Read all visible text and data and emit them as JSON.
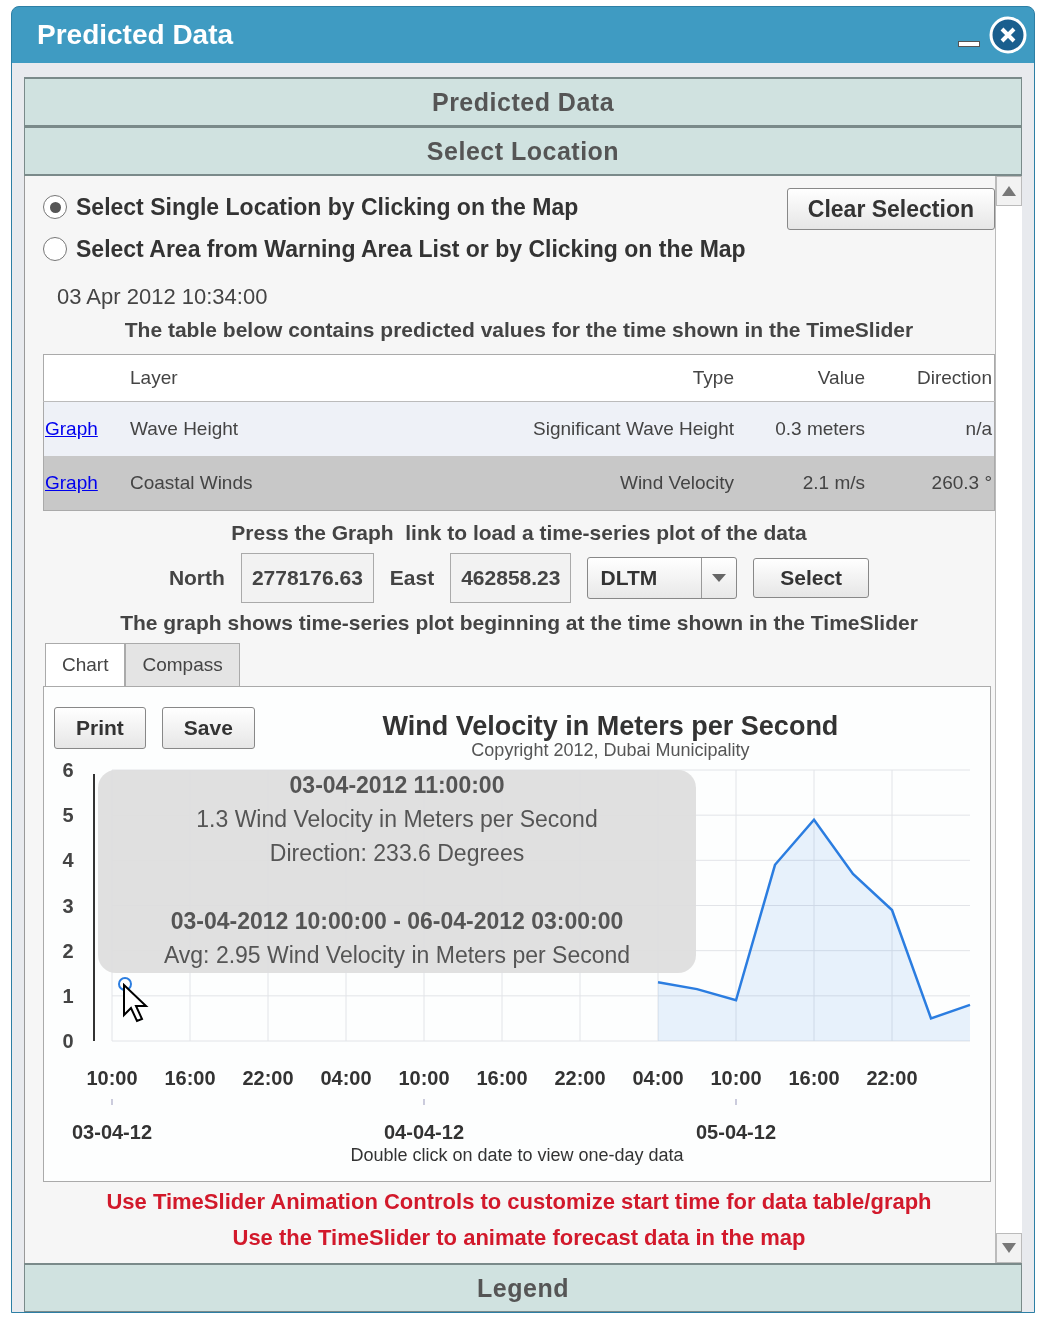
{
  "window": {
    "title": "Predicted Data"
  },
  "accordion": [
    {
      "title": "Predicted Data",
      "expanded": false
    },
    {
      "title": "Select Location",
      "expanded": true
    },
    {
      "title": "Legend",
      "expanded": false
    }
  ],
  "location": {
    "options": [
      {
        "label": "Select Single Location by Clicking on the Map",
        "selected": true
      },
      {
        "label": "Select Area from Warning Area List or by Clicking on the Map",
        "selected": false
      }
    ],
    "clear_button": "Clear Selection",
    "timestamp": "03 Apr 2012 10:34:00",
    "table_note": "The table below contains predicted values for the time shown in the TimeSlider",
    "table": {
      "columns": [
        "Layer",
        "Type",
        "Value",
        "Direction"
      ],
      "rows": [
        {
          "link": "Graph",
          "layer": "Wave Height",
          "type": "Significant Wave Height",
          "value": "0.3 meters",
          "direction": "n/a",
          "selected": false
        },
        {
          "link": "Graph",
          "layer": "Coastal Winds",
          "type": "Wind Velocity",
          "value": "2.1 m/s",
          "direction": "260.3 °",
          "selected": true
        }
      ]
    },
    "graph_note": "Press the Graph  link to load a time-series plot of the data",
    "north": {
      "label": "North",
      "value": "2778176.63"
    },
    "east": {
      "label": "East",
      "value": "462858.23"
    },
    "projection": {
      "value": "DLTM"
    },
    "select_button": "Select",
    "graph_note_2": "The graph shows time-series plot beginning at the time shown in the TimeSlider",
    "tabs": [
      {
        "label": "Chart",
        "selected": true
      },
      {
        "label": "Compass",
        "selected": false
      }
    ],
    "chart": {
      "print_button": "Print",
      "save_button": "Save",
      "subtitle": "Copyright 2012, Dubai Municipality",
      "chart_data": {
        "type": "area",
        "title": "Wind Velocity in Meters per Second",
        "categories": [
          "10:00",
          null,
          "16:00",
          null,
          "22:00",
          null,
          "04:00",
          null,
          "10:00",
          null,
          "16:00",
          null,
          "22:00",
          null,
          "04:00",
          null,
          "10:00",
          null,
          "16:00",
          null,
          "22:00",
          null,
          null
        ],
        "series": [
          {
            "color": "#2b7de0",
            "values": [
              null,
              null,
              null,
              null,
              null,
              null,
              null,
              null,
              null,
              null,
              null,
              null,
              null,
              null,
              1.3,
              1.15,
              0.9,
              3.9,
              4.9,
              3.7,
              2.9,
              0.5,
              0.8
            ]
          }
        ],
        "ylim": [
          0,
          6
        ],
        "grid": true,
        "yticks": [
          0,
          1,
          2,
          3,
          4,
          5,
          6
        ]
      },
      "date_labels": [
        "03-04-12",
        "04-04-12",
        "05-04-12"
      ],
      "tooltip": {
        "time": "03-04-2012 11:00:00",
        "reading": "1.3 Wind Velocity in Meters per Second",
        "direction": "Direction: 233.6 Degrees",
        "range": "03-04-2012 10:00:00 - 06-04-2012 03:00:00",
        "average": "Avg: 2.95 Wind Velocity in Meters per Second"
      },
      "footnote": "Double click on date to view one-day data"
    },
    "warnings": [
      "Use TimeSlider Animation Controls to customize start time for data table/graph",
      "Use the TimeSlider to animate forecast data in the map"
    ]
  }
}
